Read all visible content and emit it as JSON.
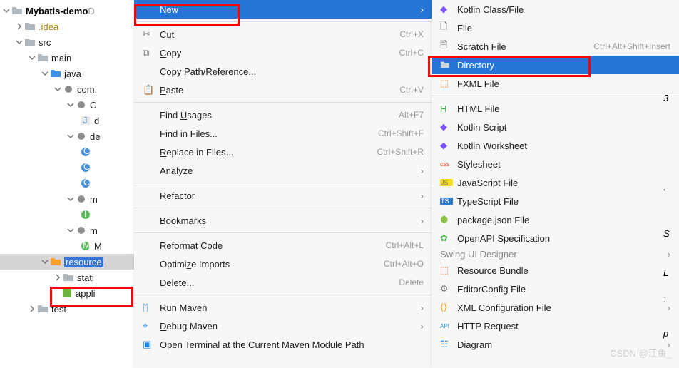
{
  "tree": {
    "root": "Mybatis-demo",
    "root_suffix": " D",
    "idea": ".idea",
    "src": "src",
    "main": "main",
    "java": "java",
    "pkg1": "com.",
    "pkg1b": "C",
    "pkg1c": "d",
    "pkg1d": "m",
    "pkg1e": "M",
    "pkg2": "de",
    "c1": "",
    "c2": "",
    "c3": "",
    "resources": "resource",
    "static": "stati",
    "applic": "appli",
    "test": "test"
  },
  "rb": {
    "new": [
      188,
      6,
      148,
      30
    ],
    "dir": [
      600,
      80,
      230,
      30
    ],
    "res": [
      72,
      404,
      115,
      26
    ]
  },
  "menu1": {
    "new": "New",
    "cut": "Cut",
    "cut_mn": "t",
    "cut_sc": "Ctrl+X",
    "copy": "Copy",
    "copy_mn": "C",
    "copy_sc": "Ctrl+C",
    "copypath": "Copy Path/Reference...",
    "paste": "Paste",
    "paste_mn": "P",
    "paste_sc": "Ctrl+V",
    "findu": "Find Usages",
    "findu_mn": "U",
    "findu_sc": "Alt+F7",
    "findf": "Find in Files...",
    "findf_sc": "Ctrl+Shift+F",
    "replf": "Replace in Files...",
    "replf_mn": "R",
    "replf_sc": "Ctrl+Shift+R",
    "analyze": "Analyze",
    "analyze_mn": "z",
    "refactor": "Refactor",
    "refactor_mn": "R",
    "bookmarks": "Bookmarks",
    "reformat": "Reformat Code",
    "reformat_mn": "R",
    "reformat_sc": "Ctrl+Alt+L",
    "optimports": "Optimize Imports",
    "optimports_mn": "z",
    "optimports_sc": "Ctrl+Alt+O",
    "delete": "Delete...",
    "delete_mn": "D",
    "delete_sc": "Delete",
    "runmvn": "Run Maven",
    "runmvn_mn": "R",
    "debugmvn": "Debug Maven",
    "debugmvn_mn": "D",
    "openterm": "Open Terminal at the Current Maven Module Path"
  },
  "menu2": {
    "kclass": "Kotlin Class/File",
    "file": "File",
    "scratch": "Scratch File",
    "scratch_sc": "Ctrl+Alt+Shift+Insert",
    "dir": "Directory",
    "fxml": "FXML File",
    "html": "HTML File",
    "kscript": "Kotlin Script",
    "kws": "Kotlin Worksheet",
    "css": "Stylesheet",
    "js": "JavaScript File",
    "ts": "TypeScript File",
    "pkgjson": "package.json File",
    "openapi": "OpenAPI Specification",
    "swing_section": "Swing UI Designer",
    "resbundle": "Resource Bundle",
    "editorcfg": "EditorConfig File",
    "xmlcfg": "XML Configuration File",
    "httpreq": "HTTP Request",
    "diagram": "Diagram"
  },
  "rc": {
    "a": "3",
    "b": ".",
    "c": "S",
    "d": "L",
    "e": ":",
    "f": "p"
  },
  "watermark": "CSDN @江鱼_"
}
